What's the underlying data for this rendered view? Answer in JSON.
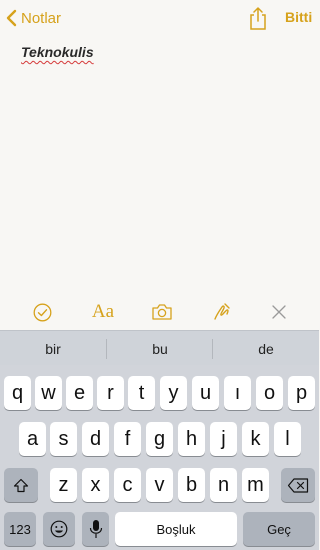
{
  "nav": {
    "back_label": "Notlar",
    "done_label": "Bitti"
  },
  "note": {
    "text": "Teknokulis"
  },
  "accent_color": "#d6a21c",
  "toolbar": {
    "format_label": "Aa"
  },
  "suggestions": [
    "bir",
    "bu",
    "de"
  ],
  "keyboard": {
    "row1": [
      "q",
      "w",
      "e",
      "r",
      "t",
      "y",
      "u",
      "ı",
      "o",
      "p"
    ],
    "row2": [
      "a",
      "s",
      "d",
      "f",
      "g",
      "h",
      "j",
      "k",
      "l"
    ],
    "row3": [
      "z",
      "x",
      "c",
      "v",
      "b",
      "n",
      "m"
    ],
    "numbers_label": "123",
    "space_label": "Boşluk",
    "return_label": "Geç"
  }
}
